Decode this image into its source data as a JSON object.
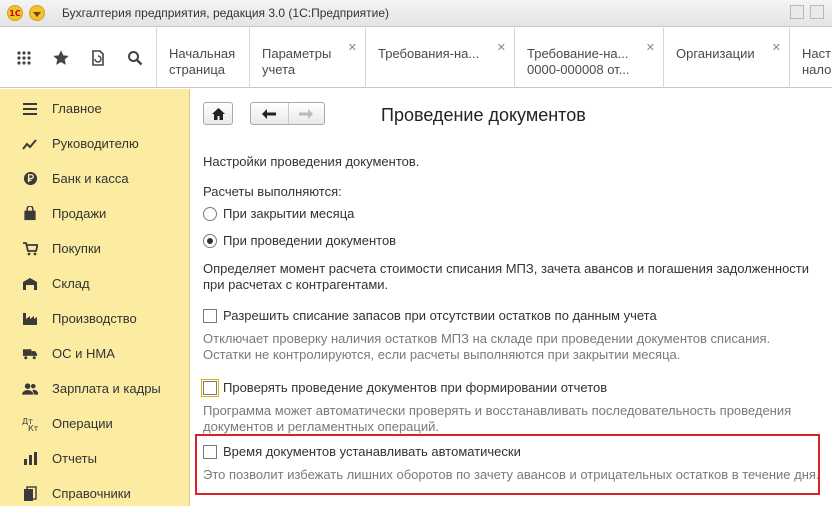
{
  "window": {
    "logo_text": "1C",
    "title": "Бухгалтерия предприятия, редакция 3.0  (1С:Предприятие)"
  },
  "toolbar": {
    "icons": [
      "apps-grid-icon",
      "favorites-star-icon",
      "history-icon",
      "search-icon"
    ]
  },
  "tabs": [
    {
      "line1": "Начальная",
      "line2": "страница",
      "closable": false
    },
    {
      "line1": "Параметры",
      "line2": "учета",
      "closable": true
    },
    {
      "line1": "Требования-на...",
      "line2": "",
      "closable": true
    },
    {
      "line1": "Требование-на...",
      "line2": "0000-000008 от...",
      "closable": true
    },
    {
      "line1": "Организации",
      "line2": "",
      "closable": true
    },
    {
      "line1": "Наст",
      "line2": "нало",
      "closable": false
    }
  ],
  "sidebar": {
    "items": [
      {
        "label": "Главное",
        "icon": "menu-lines-icon"
      },
      {
        "label": "Руководителю",
        "icon": "trend-chart-icon"
      },
      {
        "label": "Банк и касса",
        "icon": "coin-icon"
      },
      {
        "label": "Продажи",
        "icon": "shopping-bag-icon"
      },
      {
        "label": "Покупки",
        "icon": "shopping-cart-icon"
      },
      {
        "label": "Склад",
        "icon": "warehouse-icon"
      },
      {
        "label": "Производство",
        "icon": "factory-icon"
      },
      {
        "label": "ОС и НМА",
        "icon": "truck-icon"
      },
      {
        "label": "Зарплата и кадры",
        "icon": "people-icon"
      },
      {
        "label": "Операции",
        "icon": "operations-icon"
      },
      {
        "label": "Отчеты",
        "icon": "report-chart-icon"
      },
      {
        "label": "Справочники",
        "icon": "books-icon"
      }
    ]
  },
  "page": {
    "title": "Проведение документов",
    "intro": "Настройки проведения документов.",
    "calc_label": "Расчеты выполняются:",
    "radio_options": [
      {
        "label": "При закрытии месяца",
        "selected": false
      },
      {
        "label": "При проведении документов",
        "selected": true
      }
    ],
    "calc_desc": [
      "Определяет момент расчета стоимости списания МПЗ, зачета авансов и погашения задолженности",
      "при расчетах с контрагентами."
    ],
    "options": [
      {
        "label": "Разрешить списание запасов при отсутствии остатков по данным учета",
        "checked": false,
        "hint": [
          "Отключает проверку наличия остатков МПЗ на складе при проведении документов списания.",
          "Остатки не контролируются, если расчеты выполняются при закрытии месяца."
        ]
      },
      {
        "label": "Проверять проведение документов при формировании отчетов",
        "checked": false,
        "hint": [
          "Программа может автоматически проверять и восстанавливать последовательность проведения",
          "документов и регламентных операций."
        ]
      },
      {
        "label": "Время документов устанавливать автоматически",
        "checked": false,
        "hint": [
          "Это позволит избежать лишних оборотов по зачету авансов и отрицательных остатков в течение дня."
        ]
      }
    ]
  },
  "colors": {
    "sidebar_bg": "#fbeca2",
    "highlight_border": "#d9222a",
    "hint_text": "#7a7a7a"
  }
}
